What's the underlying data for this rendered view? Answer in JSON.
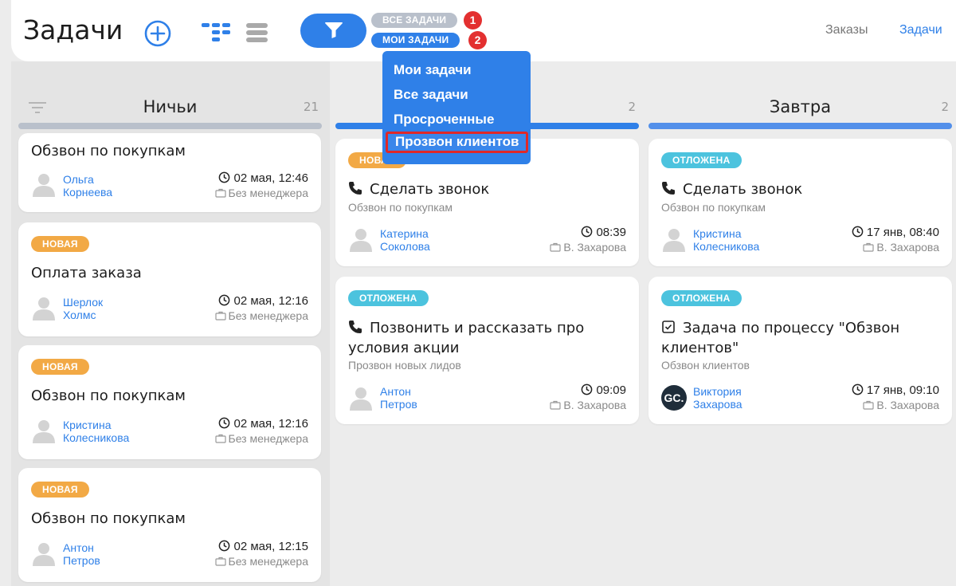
{
  "header": {
    "title": "Задачи",
    "chip_all": "ВСЕ ЗАДАЧИ",
    "chip_my": "МОИ ЗАДАЧИ",
    "badge_1": "1",
    "badge_2": "2",
    "nav_orders": "Заказы",
    "nav_tasks": "Задачи"
  },
  "dropdown": {
    "items": [
      "Мои задачи",
      "Все задачи",
      "Просроченные",
      "Прозвон клиентов"
    ],
    "selected_index": 3
  },
  "colors": {
    "accent": "#2f80e8",
    "tag_new": "#f2a945",
    "tag_postponed": "#4cc3de",
    "bar_none": "#b9c0cb",
    "highlight": "#e02828"
  },
  "columns": [
    {
      "name": "Ничьи",
      "count": "21",
      "cards": [
        {
          "tag": "",
          "title": "Обзвон по покупкам",
          "person": [
            "Ольга",
            "Корнеева"
          ],
          "time": "02 мая, 12:46",
          "manager": "Без менеджера"
        },
        {
          "tag": "НОВАЯ",
          "title": "Оплата заказа",
          "person": [
            "Шерлок",
            "Холмс"
          ],
          "time": "02 мая, 12:16",
          "manager": "Без менеджера"
        },
        {
          "tag": "НОВАЯ",
          "title": "Обзвон по покупкам",
          "person": [
            "Кристина",
            "Колесникова"
          ],
          "time": "02 мая, 12:16",
          "manager": "Без менеджера"
        },
        {
          "tag": "НОВАЯ",
          "title": "Обзвон по покупкам",
          "person": [
            "Антон",
            "Петров"
          ],
          "time": "02 мая, 12:15",
          "manager": "Без менеджера"
        }
      ]
    },
    {
      "name": "",
      "count": "2",
      "cards": [
        {
          "tag": "НОВАЯ",
          "title": "Сделать звонок",
          "subtitle": "Обзвон по покупкам",
          "person": [
            "Катерина",
            "Соколова"
          ],
          "time": "08:39",
          "manager": "В. Захарова"
        },
        {
          "tag": "ОТЛОЖЕНА",
          "title_lines": [
            "Позвонить и рассказать про",
            "условия акции"
          ],
          "subtitle": "Прозвон новых лидов",
          "person": [
            "Антон",
            "Петров"
          ],
          "time": "09:09",
          "manager": "В. Захарова"
        }
      ]
    },
    {
      "name": "Завтра",
      "count": "2",
      "cards": [
        {
          "tag": "ОТЛОЖЕНА",
          "title": "Сделать звонок",
          "subtitle": "Обзвон по покупкам",
          "person": [
            "Кристина",
            "Колесникова"
          ],
          "time": "17 янв, 08:40",
          "manager": "В. Захарова"
        },
        {
          "tag": "ОТЛОЖЕНА",
          "title_lines": [
            "Задача по процессу \"Обзвон",
            "клиентов\""
          ],
          "subtitle": "Обзвон клиентов",
          "person": [
            "Виктория",
            "Захарова"
          ],
          "avatar_text": "GC.",
          "time": "17 янв, 09:10",
          "manager": "В. Захарова"
        }
      ]
    }
  ]
}
